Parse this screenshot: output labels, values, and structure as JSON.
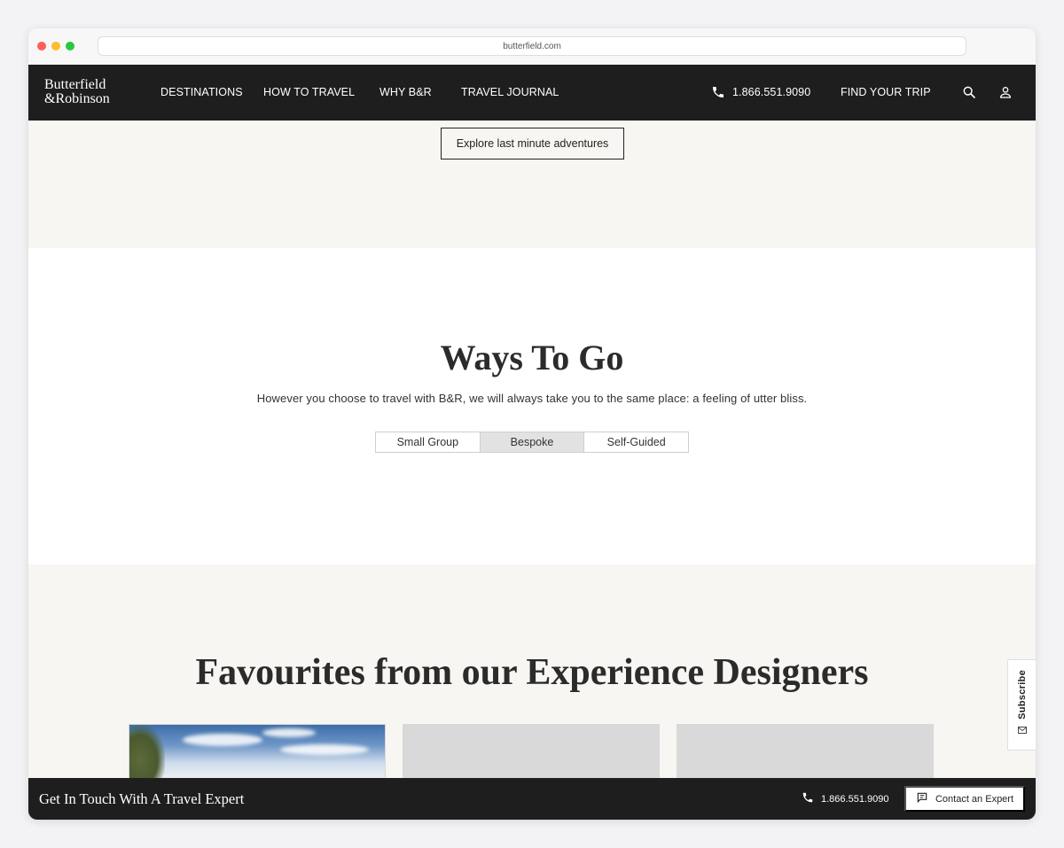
{
  "browser": {
    "url": "butterfield.com"
  },
  "nav": {
    "logo_line1": "Butterfield",
    "logo_line2": "&Robinson",
    "links": [
      "DESTINATIONS",
      "HOW TO TRAVEL",
      "WHY B&R",
      "TRAVEL JOURNAL"
    ],
    "phone": "1.866.551.9090",
    "find_trip": "FIND YOUR TRIP",
    "icons": [
      "phone-icon",
      "search-icon",
      "user-icon"
    ]
  },
  "hero": {
    "explore_label": "Explore last minute adventures"
  },
  "ways": {
    "title": "Ways To Go",
    "subtitle": "However you choose to travel with B&R, we will always take you to the same place: a feeling of utter bliss.",
    "tabs": [
      {
        "label": "Small Group",
        "active": false
      },
      {
        "label": "Bespoke",
        "active": true
      },
      {
        "label": "Self-Guided",
        "active": false
      }
    ]
  },
  "favourites": {
    "title": "Favourites from our Experience Designers"
  },
  "subscribe": {
    "label": "Subscribe",
    "icon": "mail-icon"
  },
  "footer": {
    "title": "Get In Touch With A Travel Expert",
    "phone": "1.866.551.9090",
    "contact_label": "Contact an Expert",
    "icons": [
      "phone-icon",
      "chat-icon"
    ]
  },
  "colors": {
    "dark": "#1e1e1e",
    "cream": "#f7f6f2",
    "tab_active": "#e2e2e2"
  }
}
